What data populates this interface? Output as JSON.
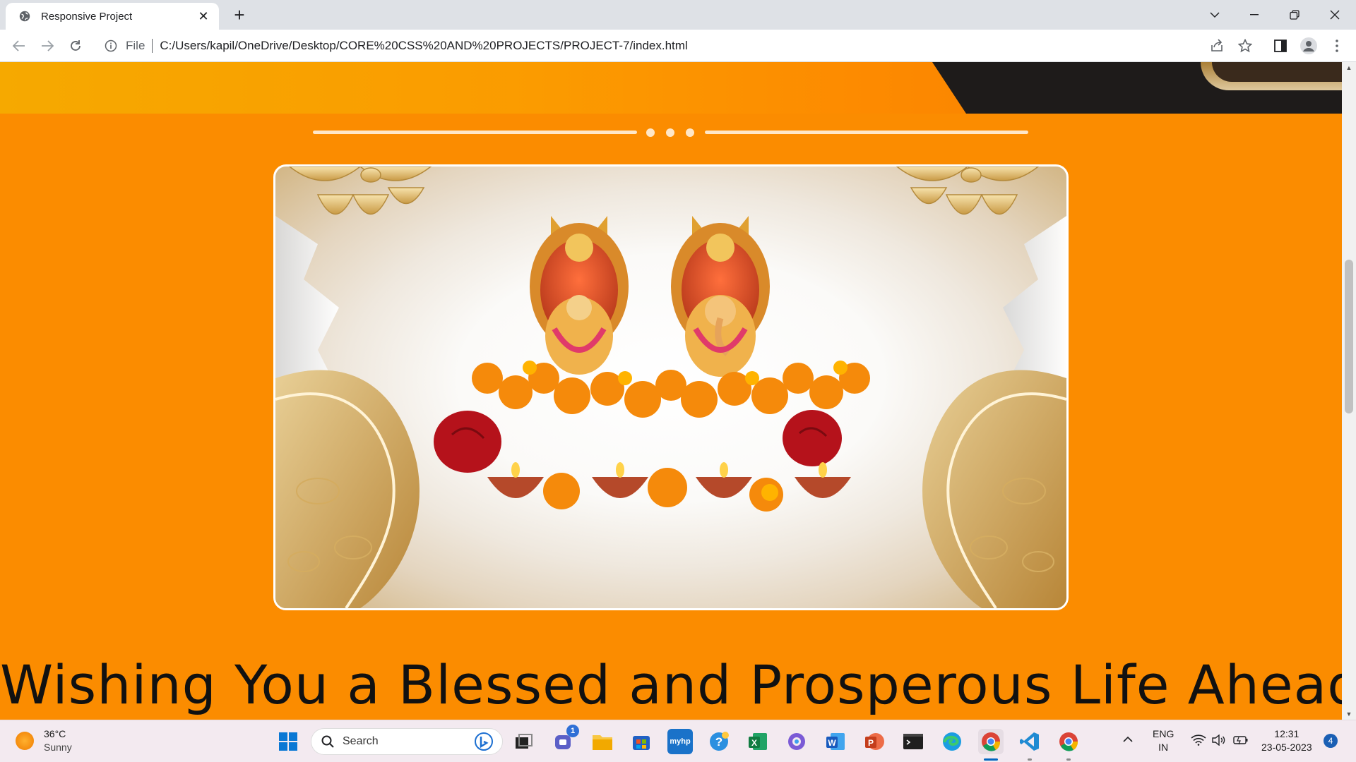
{
  "browser": {
    "tab_title": "Responsive Project",
    "new_tab_label": "+",
    "file_label": "File",
    "url": "C:/Users/kapil/OneDrive/Desktop/CORE%20CSS%20AND%20PROJECTS/PROJECT-7/index.html"
  },
  "page": {
    "headline": "Wishing You a Blessed and Prosperous Life Ahead",
    "slider_dot_count": 3,
    "colors": {
      "background": "#fb8c00",
      "divider": "#ffe7c8"
    }
  },
  "taskbar": {
    "weather": {
      "temp": "36°C",
      "condition": "Sunny"
    },
    "search_placeholder": "Search",
    "teams_badge": "1",
    "language": {
      "line1": "ENG",
      "line2": "IN"
    },
    "clock": {
      "time": "12:31",
      "date": "23-05-2023"
    },
    "notification_count": "4",
    "apps": [
      "windows-start",
      "search",
      "task-view",
      "teams",
      "file-explorer",
      "microsoft-store",
      "myhp",
      "tips",
      "excel",
      "copilot",
      "word",
      "powerpoint",
      "terminal",
      "edge",
      "chrome",
      "vscode",
      "chrome"
    ]
  }
}
